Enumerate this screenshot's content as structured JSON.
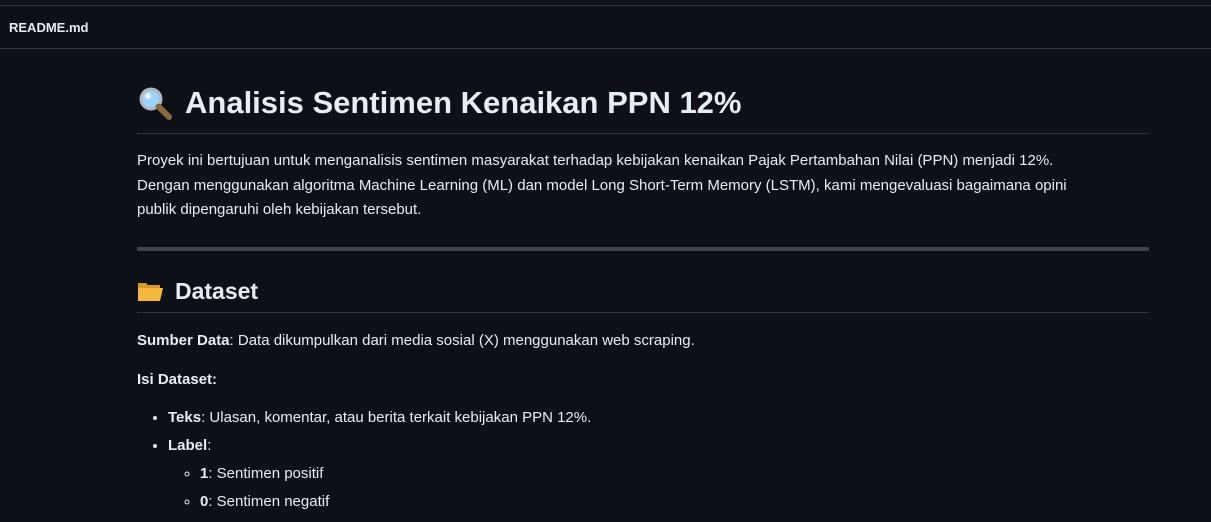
{
  "file": {
    "name": "README.md"
  },
  "readme": {
    "title": "Analisis Sentimen Kenaikan PPN 12%",
    "title_icon": "magnifying-glass-icon",
    "intro_line1": "Proyek ini bertujuan untuk menganalisis sentimen masyarakat terhadap kebijakan kenaikan Pajak Pertambahan Nilai (PPN) menjadi 12%.",
    "intro_line2": "Dengan menggunakan algoritma Machine Learning (ML) dan model Long Short-Term Memory (LSTM), kami mengevaluasi bagaimana opini",
    "intro_line3": "publik dipengaruhi oleh kebijakan tersebut.",
    "dataset_heading": "Dataset",
    "dataset_icon": "open-folder-icon",
    "source_label": "Sumber Data",
    "source_text": ": Data dikumpulkan dari media sosial (X) menggunakan web scraping.",
    "contents_label": "Isi Dataset:",
    "items": [
      {
        "label": "Teks",
        "text": ": Ulasan, komentar, atau berita terkait kebijakan PPN 12%."
      },
      {
        "label": "Label",
        "text": ":"
      }
    ],
    "sub_items": [
      {
        "label": "1",
        "text": ": Sentimen positif"
      },
      {
        "label": "0",
        "text": ": Sentimen negatif"
      }
    ]
  },
  "colors": {
    "background": "#0d1117",
    "text": "#e6edf3",
    "border": "#30363d",
    "rule": "#3d444d"
  }
}
